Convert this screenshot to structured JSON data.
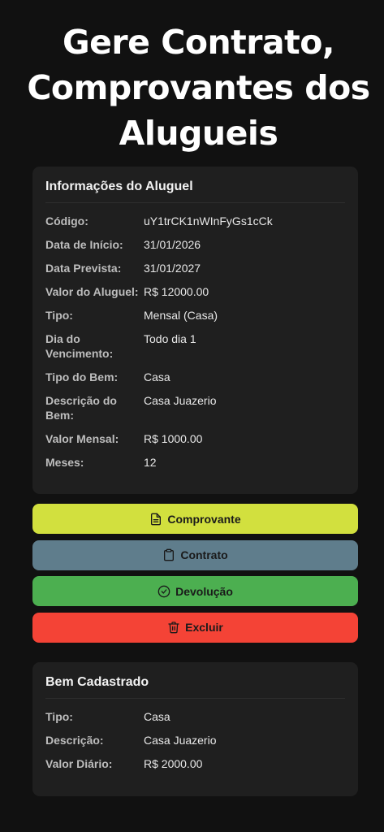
{
  "header": {
    "title": "Gere Contrato, Comprovantes dos Alugueis"
  },
  "info": {
    "title": "Informações do Aluguel",
    "rows": [
      {
        "label": "Código:",
        "value": "uY1trCK1nWInFyGs1cCk"
      },
      {
        "label": "Data de Início:",
        "value": "31/01/2026"
      },
      {
        "label": "Data Prevista:",
        "value": "31/01/2027"
      },
      {
        "label": "Valor do Aluguel:",
        "value": "R$ 12000.00"
      },
      {
        "label": "Tipo:",
        "value": "Mensal (Casa)"
      },
      {
        "label": "Dia do Vencimento:",
        "value": "Todo dia 1"
      },
      {
        "label": "Tipo do Bem:",
        "value": "Casa"
      },
      {
        "label": "Descrição do Bem:",
        "value": "Casa Juazerio"
      },
      {
        "label": "Valor Mensal:",
        "value": "R$ 1000.00"
      },
      {
        "label": "Meses:",
        "value": "12"
      }
    ]
  },
  "actions": {
    "comprovante_label": "Comprovante",
    "contrato_label": "Contrato",
    "devolucao_label": "Devolução",
    "excluir_label": "Excluir"
  },
  "bem": {
    "title": "Bem Cadastrado",
    "rows": [
      {
        "label": "Tipo:",
        "value": "Casa"
      },
      {
        "label": "Descrição:",
        "value": "Casa Juazerio"
      },
      {
        "label": "Valor Diário:",
        "value": "R$ 2000.00"
      }
    ]
  },
  "colors": {
    "background": "#111111",
    "card": "#1f1f1f",
    "comprovante": "#d2e03e",
    "contrato": "#5f7d8c",
    "devolucao": "#4caf50",
    "excluir": "#f44336"
  },
  "icons": {
    "comprovante": "file-text-icon",
    "contrato": "clipboard-icon",
    "devolucao": "check-circle-icon",
    "excluir": "trash-icon"
  }
}
